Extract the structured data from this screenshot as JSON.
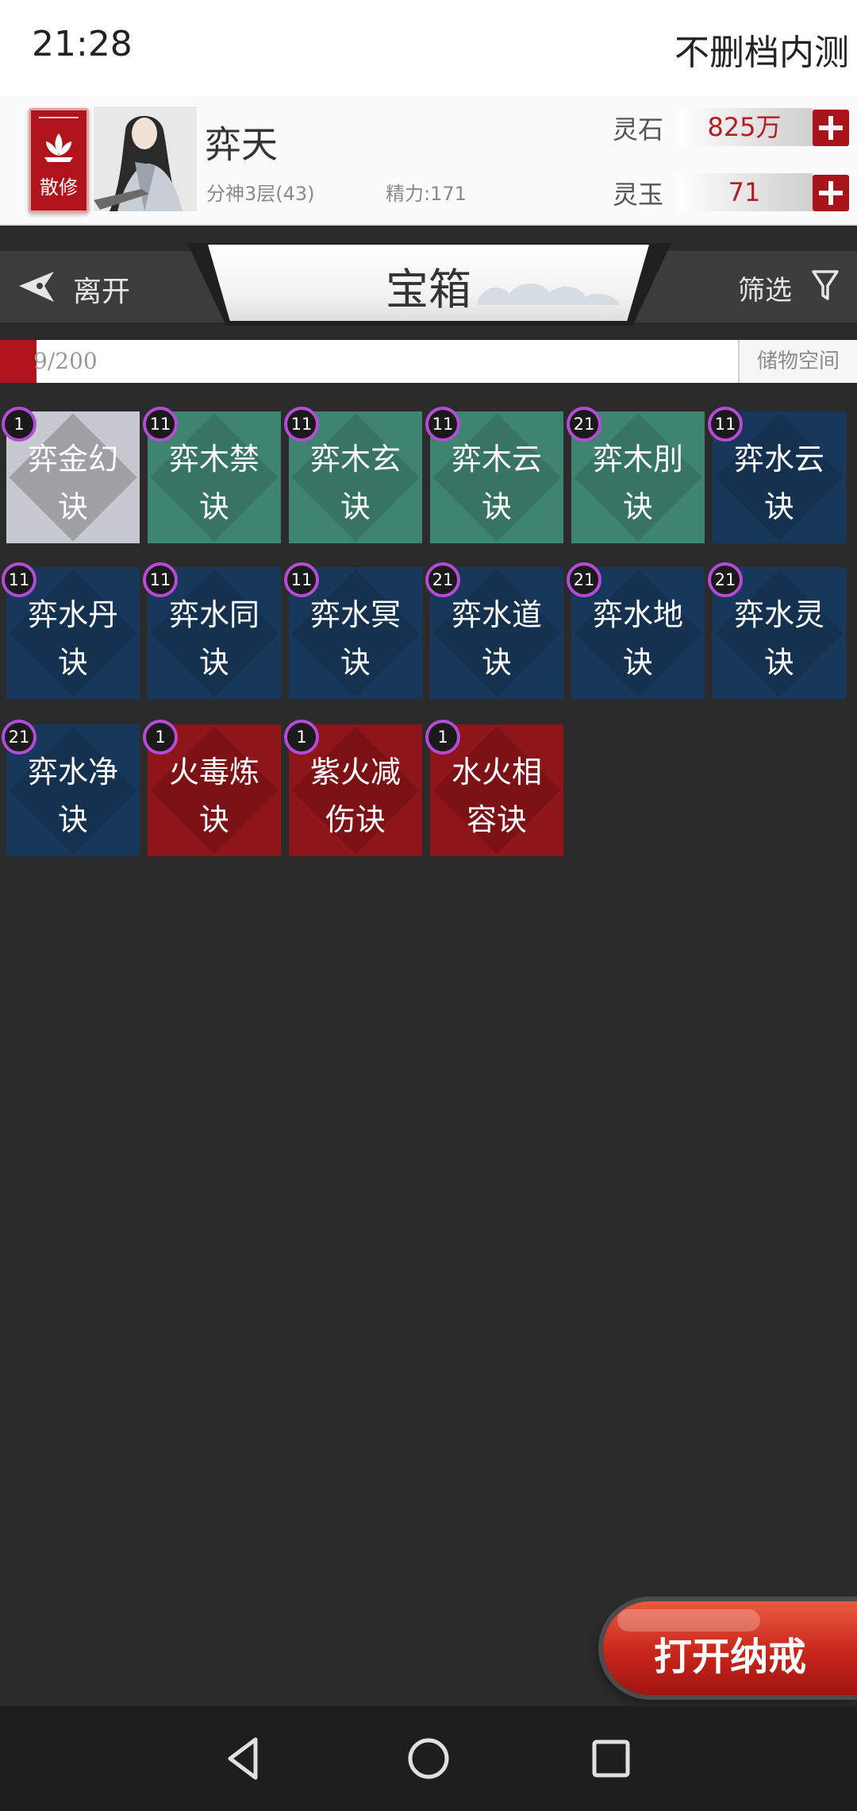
{
  "status_bar": {
    "time": "21:28",
    "title": "不删档内测"
  },
  "profile": {
    "sect_label": "散修",
    "name": "弈天",
    "rank": "分神3层(43)",
    "energy": "精力:171",
    "currencies": [
      {
        "label": "灵石",
        "value": "825万"
      },
      {
        "label": "灵玉",
        "value": "71"
      }
    ]
  },
  "title_bar": {
    "leave_label": "离开",
    "title": "宝箱",
    "filter_label": "筛选"
  },
  "capacity": {
    "text": "9/200",
    "used": 9,
    "total": 200,
    "label": "储物空间"
  },
  "items": [
    {
      "name": "弈金幻\n诀",
      "level": "1",
      "color": "grey"
    },
    {
      "name": "弈木禁\n诀",
      "level": "11",
      "color": "green"
    },
    {
      "name": "弈木玄\n诀",
      "level": "11",
      "color": "green"
    },
    {
      "name": "弈木云\n诀",
      "level": "11",
      "color": "green"
    },
    {
      "name": "弈木刖\n诀",
      "level": "21",
      "color": "green"
    },
    {
      "name": "弈水云\n诀",
      "level": "11",
      "color": "blue"
    },
    {
      "name": "弈水丹\n诀",
      "level": "11",
      "color": "blue"
    },
    {
      "name": "弈水同\n诀",
      "level": "11",
      "color": "blue"
    },
    {
      "name": "弈水冥\n诀",
      "level": "11",
      "color": "blue"
    },
    {
      "name": "弈水道\n诀",
      "level": "21",
      "color": "blue"
    },
    {
      "name": "弈水地\n诀",
      "level": "21",
      "color": "blue"
    },
    {
      "name": "弈水灵\n诀",
      "level": "21",
      "color": "blue"
    },
    {
      "name": "弈水净\n诀",
      "level": "21",
      "color": "blue"
    },
    {
      "name": "火毒炼\n诀",
      "level": "1",
      "color": "red"
    },
    {
      "name": "紫火减\n伤诀",
      "level": "1",
      "color": "red"
    },
    {
      "name": "水火相\n容诀",
      "level": "1",
      "color": "red"
    }
  ],
  "open_ring_button": "打开纳戒",
  "nav": {
    "back": "back-icon",
    "home": "home-icon",
    "recents": "recents-icon"
  },
  "colors": {
    "accent_red": "#b0141a",
    "badge_ring": "#b54bd6",
    "item_grey": "#c6c9d0",
    "item_green": "#3f8470",
    "item_blue": "#17385a",
    "item_red": "#8e151a"
  }
}
